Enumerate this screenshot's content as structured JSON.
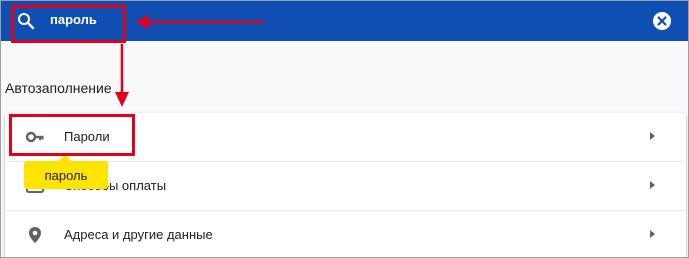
{
  "search": {
    "query": "пароль",
    "icon": "search-icon",
    "clear_icon": "close-icon"
  },
  "section": {
    "title": "Автозаполнение"
  },
  "items": [
    {
      "label": "Пароли",
      "icon": "key-icon"
    },
    {
      "label": "Способы оплаты",
      "icon": "credit-card-icon"
    },
    {
      "label": "Адреса и другие данные",
      "icon": "location-pin-icon"
    }
  ],
  "tooltip": {
    "text": "пароль"
  },
  "colors": {
    "header": "#0f4fb3",
    "annotation": "#e3001b",
    "tooltip": "#ffe400",
    "background": "#f8f9fa"
  }
}
